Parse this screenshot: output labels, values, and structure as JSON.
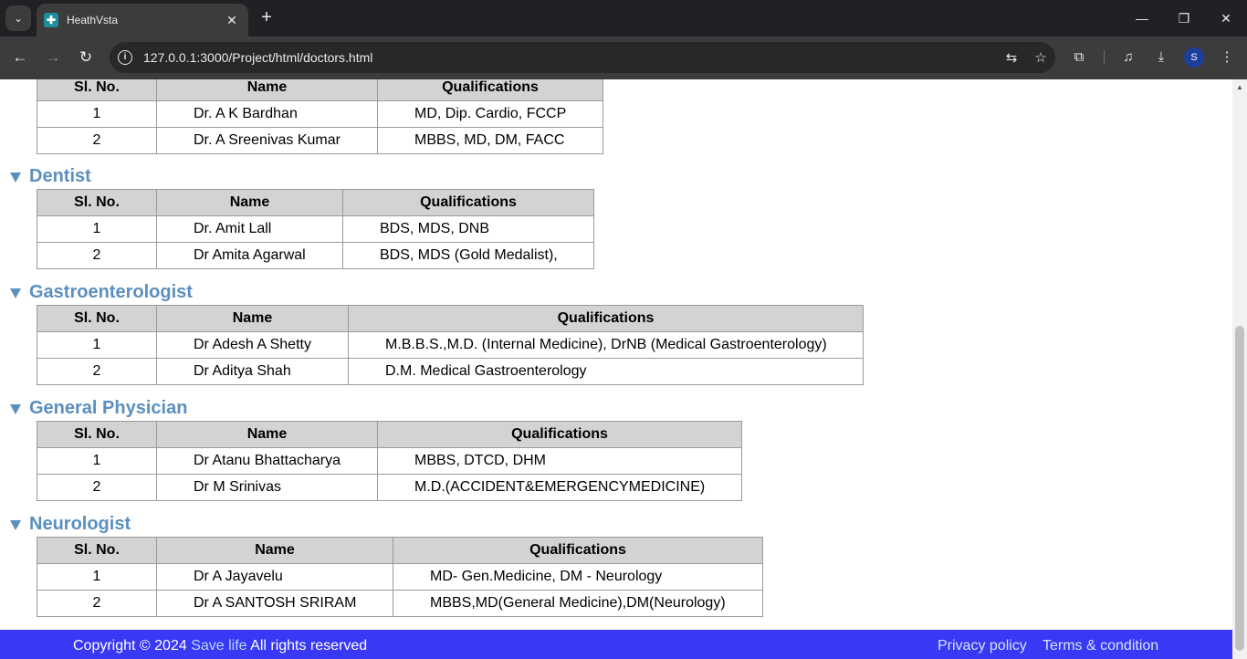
{
  "browser": {
    "tab_title": "HeathVsta",
    "tab_close": "✕",
    "new_tab": "+",
    "url": "127.0.0.1:3000/Project/html/doctors.html",
    "profile_initial": "S"
  },
  "sections": [
    {
      "title": "",
      "headers": [
        "Sl. No.",
        "Name",
        "Qualifications"
      ],
      "rows": [
        [
          "1",
          "Dr. A K Bardhan",
          "MD, Dip. Cardio, FCCP"
        ],
        [
          "2",
          "Dr. A Sreenivas Kumar",
          "MBBS, MD, DM, FACC"
        ]
      ]
    },
    {
      "title": "Dentist",
      "headers": [
        "Sl. No.",
        "Name",
        "Qualifications"
      ],
      "rows": [
        [
          "1",
          "Dr. Amit Lall",
          "BDS, MDS, DNB"
        ],
        [
          "2",
          "Dr Amita Agarwal",
          "BDS, MDS (Gold Medalist),"
        ]
      ]
    },
    {
      "title": "Gastroenterologist",
      "headers": [
        "Sl. No.",
        "Name",
        "Qualifications"
      ],
      "rows": [
        [
          "1",
          "Dr Adesh A Shetty",
          "M.B.B.S.,M.D. (Internal Medicine), DrNB (Medical Gastroenterology)"
        ],
        [
          "2",
          "Dr Aditya Shah",
          "D.M. Medical Gastroenterology"
        ]
      ]
    },
    {
      "title": "General Physician",
      "headers": [
        "Sl. No.",
        "Name",
        "Qualifications"
      ],
      "rows": [
        [
          "1",
          "Dr Atanu Bhattacharya",
          "MBBS, DTCD, DHM"
        ],
        [
          "2",
          "Dr M Srinivas",
          "M.D.(ACCIDENT&EMERGENCYMEDICINE)"
        ]
      ]
    },
    {
      "title": "Neurologist",
      "headers": [
        "Sl. No.",
        "Name",
        "Qualifications"
      ],
      "rows": [
        [
          "1",
          "Dr A Jayavelu",
          "MD- Gen.Medicine, DM - Neurology"
        ],
        [
          "2",
          "Dr A SANTOSH SRIRAM",
          "MBBS,MD(General Medicine),DM(Neurology)"
        ]
      ]
    }
  ],
  "footer": {
    "copyright": "Copyright © 2024",
    "brand": "Save life",
    "rights": "All rights reserved",
    "privacy": "Privacy policy",
    "terms": "Terms & condition"
  }
}
